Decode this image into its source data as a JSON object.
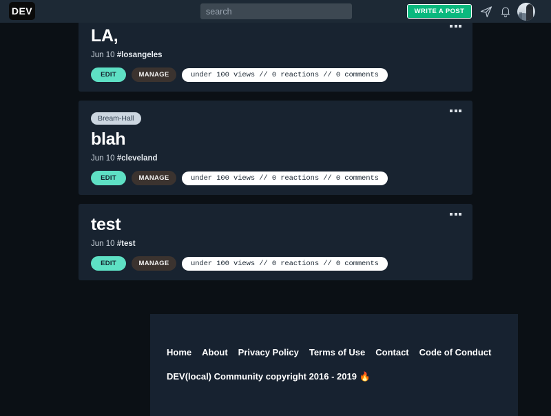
{
  "header": {
    "logo_text": "DEV",
    "search_placeholder": "search",
    "search_value": "",
    "write_post_label": "WRITE A POST",
    "icons": {
      "send": "paper-plane-icon",
      "bell": "bell-icon",
      "avatar": "user-avatar"
    }
  },
  "feed": {
    "posts": [
      {
        "org": null,
        "title": "LA,",
        "date": "Jun 10",
        "tag": "#losangeles",
        "edit_label": "EDIT",
        "manage_label": "MANAGE",
        "stats": "under 100 views // 0 reactions // 0 comments"
      },
      {
        "org": "Bream-Hall",
        "title": "blah",
        "date": "Jun 10",
        "tag": "#cleveland",
        "edit_label": "EDIT",
        "manage_label": "MANAGE",
        "stats": "under 100 views // 0 reactions // 0 comments"
      },
      {
        "org": null,
        "title": "test",
        "date": "Jun 10",
        "tag": "#test",
        "edit_label": "EDIT",
        "manage_label": "MANAGE",
        "stats": "under 100 views // 0 reactions // 0 comments"
      }
    ]
  },
  "footer": {
    "links": [
      "Home",
      "About",
      "Privacy Policy",
      "Terms of Use",
      "Contact",
      "Code of Conduct"
    ],
    "copyright": "DEV(local) Community copyright 2016 - 2019 🔥"
  },
  "colors": {
    "page_bg": "#0b1015",
    "header_bg": "#1d2935",
    "card_bg": "#182330",
    "footer_bg": "#172230",
    "accent_green": "#0ab87e",
    "accent_teal": "#5ee0c4",
    "badge_bg": "#ccd6e0"
  }
}
